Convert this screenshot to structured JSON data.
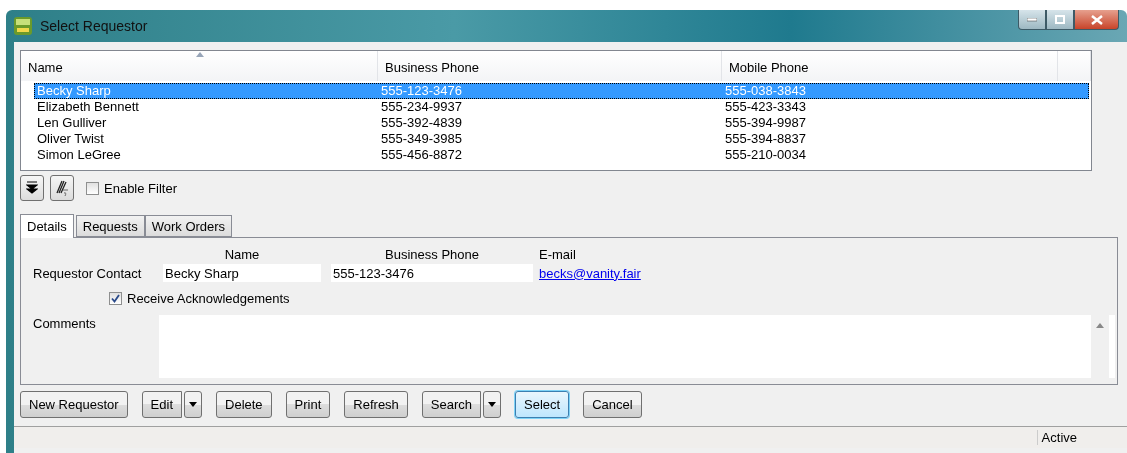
{
  "window": {
    "title": "Select Requestor"
  },
  "list": {
    "columns": [
      {
        "label": "Name",
        "sorted": true
      },
      {
        "label": "Business Phone",
        "sorted": false
      },
      {
        "label": "Mobile Phone",
        "sorted": false
      }
    ],
    "rows": [
      {
        "cells": [
          "Becky Sharp",
          "555-123-3476",
          "555-038-3843"
        ],
        "selected": true
      },
      {
        "cells": [
          "Elizabeth Bennett",
          "555-234-9937",
          "555-423-3343"
        ],
        "selected": false
      },
      {
        "cells": [
          "Len Gulliver",
          "555-392-4839",
          "555-394-9987"
        ],
        "selected": false
      },
      {
        "cells": [
          "Oliver Twist",
          "555-349-3985",
          "555-394-8837"
        ],
        "selected": false
      },
      {
        "cells": [
          "Simon LeGree",
          "555-456-8872",
          "555-210-0034"
        ],
        "selected": false
      }
    ]
  },
  "filter": {
    "label": "Enable Filter",
    "checked": false
  },
  "tabs": [
    {
      "label": "Details",
      "selected": true
    },
    {
      "label": "Requests",
      "selected": false
    },
    {
      "label": "Work Orders",
      "selected": false
    }
  ],
  "details": {
    "headings": [
      "Name",
      "Business Phone",
      "E-mail"
    ],
    "row_label": "Requestor Contact",
    "name": "Becky Sharp",
    "phone": "555-123-3476",
    "email": "becks@vanity.fair",
    "acknowledge": {
      "label": "Receive Acknowledgements",
      "checked": true
    },
    "comments_label": "Comments"
  },
  "buttons": [
    {
      "label": "New Requestor",
      "dropdown": false,
      "default": false
    },
    {
      "label": "Edit",
      "dropdown": true,
      "default": false
    },
    {
      "label": "Delete",
      "dropdown": false,
      "default": false
    },
    {
      "label": "Print",
      "dropdown": false,
      "default": false
    },
    {
      "label": "Refresh",
      "dropdown": false,
      "default": false
    },
    {
      "label": "Search",
      "dropdown": true,
      "default": false
    },
    {
      "label": "Select",
      "dropdown": false,
      "default": true
    },
    {
      "label": "Cancel",
      "dropdown": false,
      "default": false
    }
  ],
  "status_bar": {
    "status": "Active"
  }
}
